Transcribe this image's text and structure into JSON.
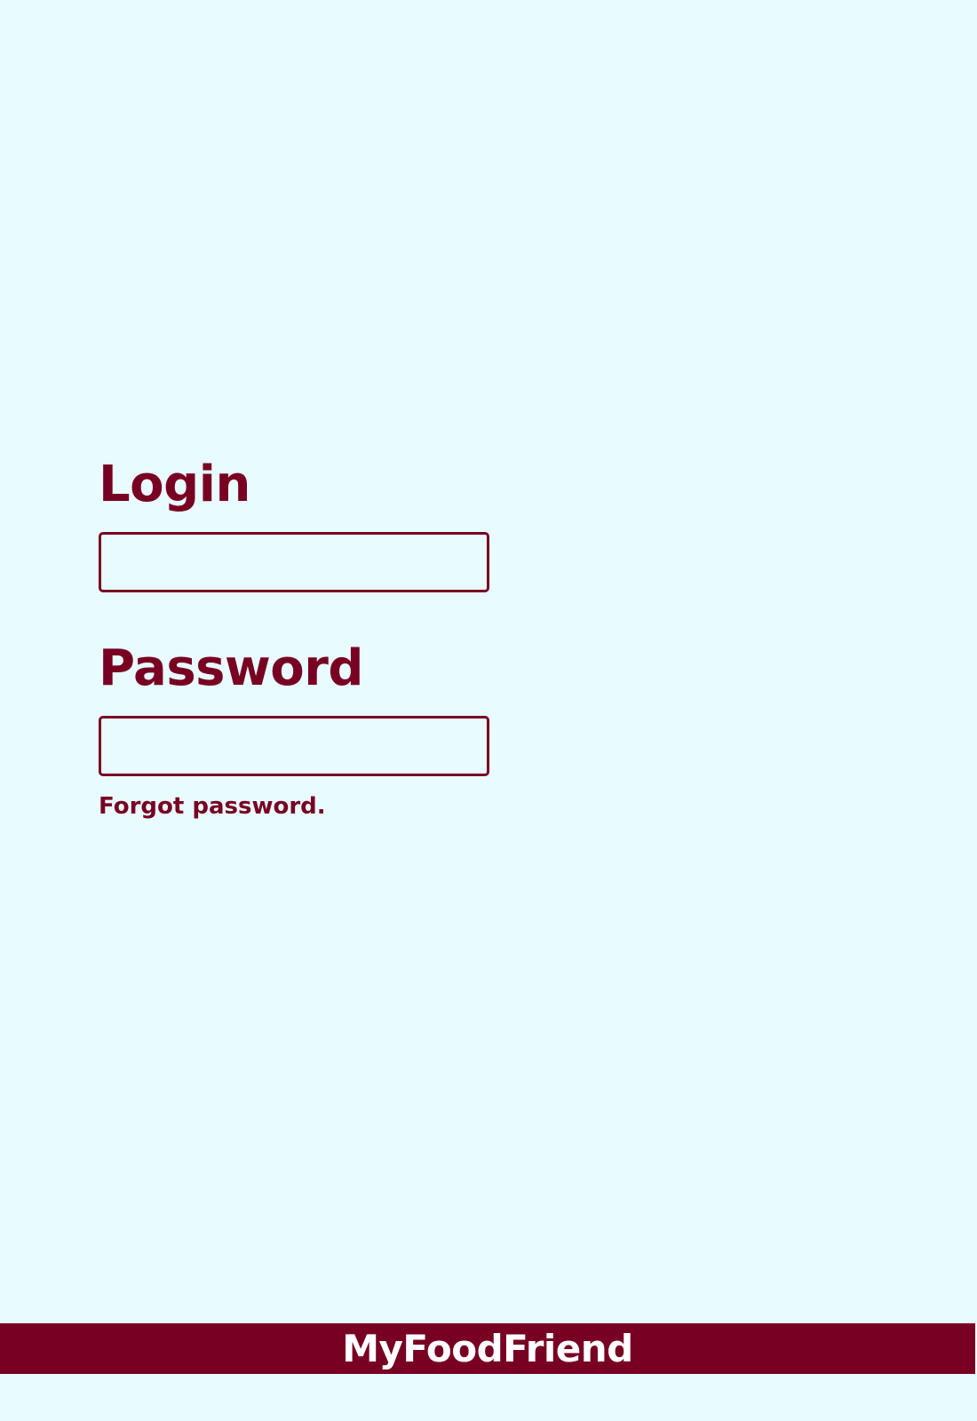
{
  "login": {
    "label": "Login",
    "value": "",
    "placeholder": ""
  },
  "password": {
    "label": "Password",
    "value": "",
    "placeholder": ""
  },
  "forgot_password": {
    "label": "Forgot password."
  },
  "footer": {
    "brand": "MyFoodFriend"
  },
  "colors": {
    "background": "#E8FCFF",
    "accent": "#780022",
    "brand_text": "#FFFFFF"
  }
}
